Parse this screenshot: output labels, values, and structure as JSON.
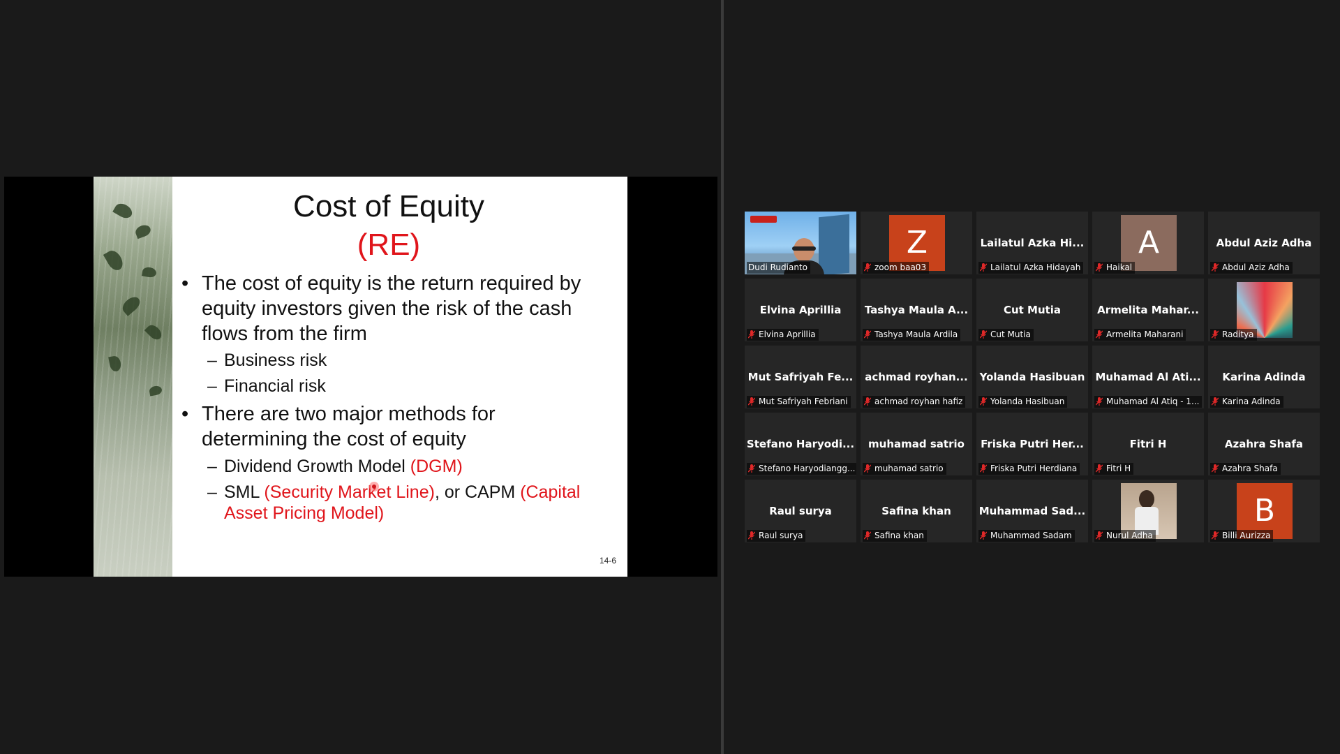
{
  "slide": {
    "title": "Cost of Equity",
    "subtitle": "(RE)",
    "bullet1": "The cost of equity is the return required by equity investors given the risk of the cash flows from the firm",
    "sub1": "Business risk",
    "sub2": "Financial risk",
    "bullet2": "There are two major methods for determining the cost of equity",
    "sub3_text": "Dividend Growth Model ",
    "sub3_red": "(DGM)",
    "sub4_text1": "SML ",
    "sub4_red1": "(Security Market Line)",
    "sub4_text2": ", or CAPM ",
    "sub4_red2": "(Capital Asset Pricing Model)",
    "page": "14-6",
    "bullet_symbol": "•",
    "dash_symbol": "–"
  },
  "participants": [
    {
      "name": "",
      "label": "Dudi Rudianto",
      "type": "video",
      "muted": false,
      "active": true
    },
    {
      "name": "",
      "label": "zoom baa03",
      "type": "avatar",
      "initial": "Z",
      "color": "#c8421b",
      "muted": true
    },
    {
      "name": "Lailatul  Azka  Hi...",
      "label": "Lailatul Azka Hidayah",
      "type": "name",
      "muted": true
    },
    {
      "name": "",
      "label": "Haikal",
      "type": "avatar",
      "initial": "A",
      "color": "#8b6b5e",
      "muted": true
    },
    {
      "name": "Abdul Aziz Adha",
      "label": "Abdul Aziz Adha",
      "type": "name",
      "muted": true
    },
    {
      "name": "Elvina Aprillia",
      "label": "Elvina Aprillia",
      "type": "name",
      "muted": true
    },
    {
      "name": "Tashya  Maula  A...",
      "label": "Tashya Maula Ardila",
      "type": "name",
      "muted": true
    },
    {
      "name": "Cut Mutia",
      "label": "Cut Mutia",
      "type": "name",
      "muted": true
    },
    {
      "name": "Armelita  Mahar...",
      "label": "Armelita Maharani",
      "type": "name",
      "muted": true
    },
    {
      "name": "",
      "label": "Raditya",
      "type": "image",
      "muted": true
    },
    {
      "name": "Mut  Safriyah  Fe...",
      "label": "Mut Safriyah Febriani",
      "type": "name",
      "muted": true
    },
    {
      "name": "achmad  royhan...",
      "label": "achmad royhan hafiz",
      "type": "name",
      "muted": true
    },
    {
      "name": "Yolanda Hasibuan",
      "label": "Yolanda Hasibuan",
      "type": "name",
      "muted": true
    },
    {
      "name": "Muhamad  Al  Ati...",
      "label": "Muhamad Al Atiq - 1...",
      "type": "name",
      "muted": true
    },
    {
      "name": "Karina Adinda",
      "label": "Karina Adinda",
      "type": "name",
      "muted": true
    },
    {
      "name": "Stefano  Haryodi...",
      "label": "Stefano Haryodiangg...",
      "type": "name",
      "muted": true
    },
    {
      "name": "muhamad satrio",
      "label": "muhamad satrio",
      "type": "name",
      "muted": true
    },
    {
      "name": "Friska  Putri  Her...",
      "label": "Friska Putri Herdiana",
      "type": "name",
      "muted": true
    },
    {
      "name": "Fitri H",
      "label": "Fitri H",
      "type": "name",
      "muted": true
    },
    {
      "name": "Azahra Shafa",
      "label": "Azahra Shafa",
      "type": "name",
      "muted": true
    },
    {
      "name": "Raul surya",
      "label": "Raul surya",
      "type": "name",
      "muted": true
    },
    {
      "name": "Safina khan",
      "label": "Safina khan",
      "type": "name",
      "muted": true
    },
    {
      "name": "Muhammad  Sad...",
      "label": "Muhammad Sadam",
      "type": "name",
      "muted": true
    },
    {
      "name": "",
      "label": "Nurul Adha",
      "type": "photo",
      "muted": true
    },
    {
      "name": "",
      "label": "Billi Aurizza",
      "type": "avatar",
      "initial": "B",
      "color": "#c8421b",
      "muted": true
    }
  ]
}
